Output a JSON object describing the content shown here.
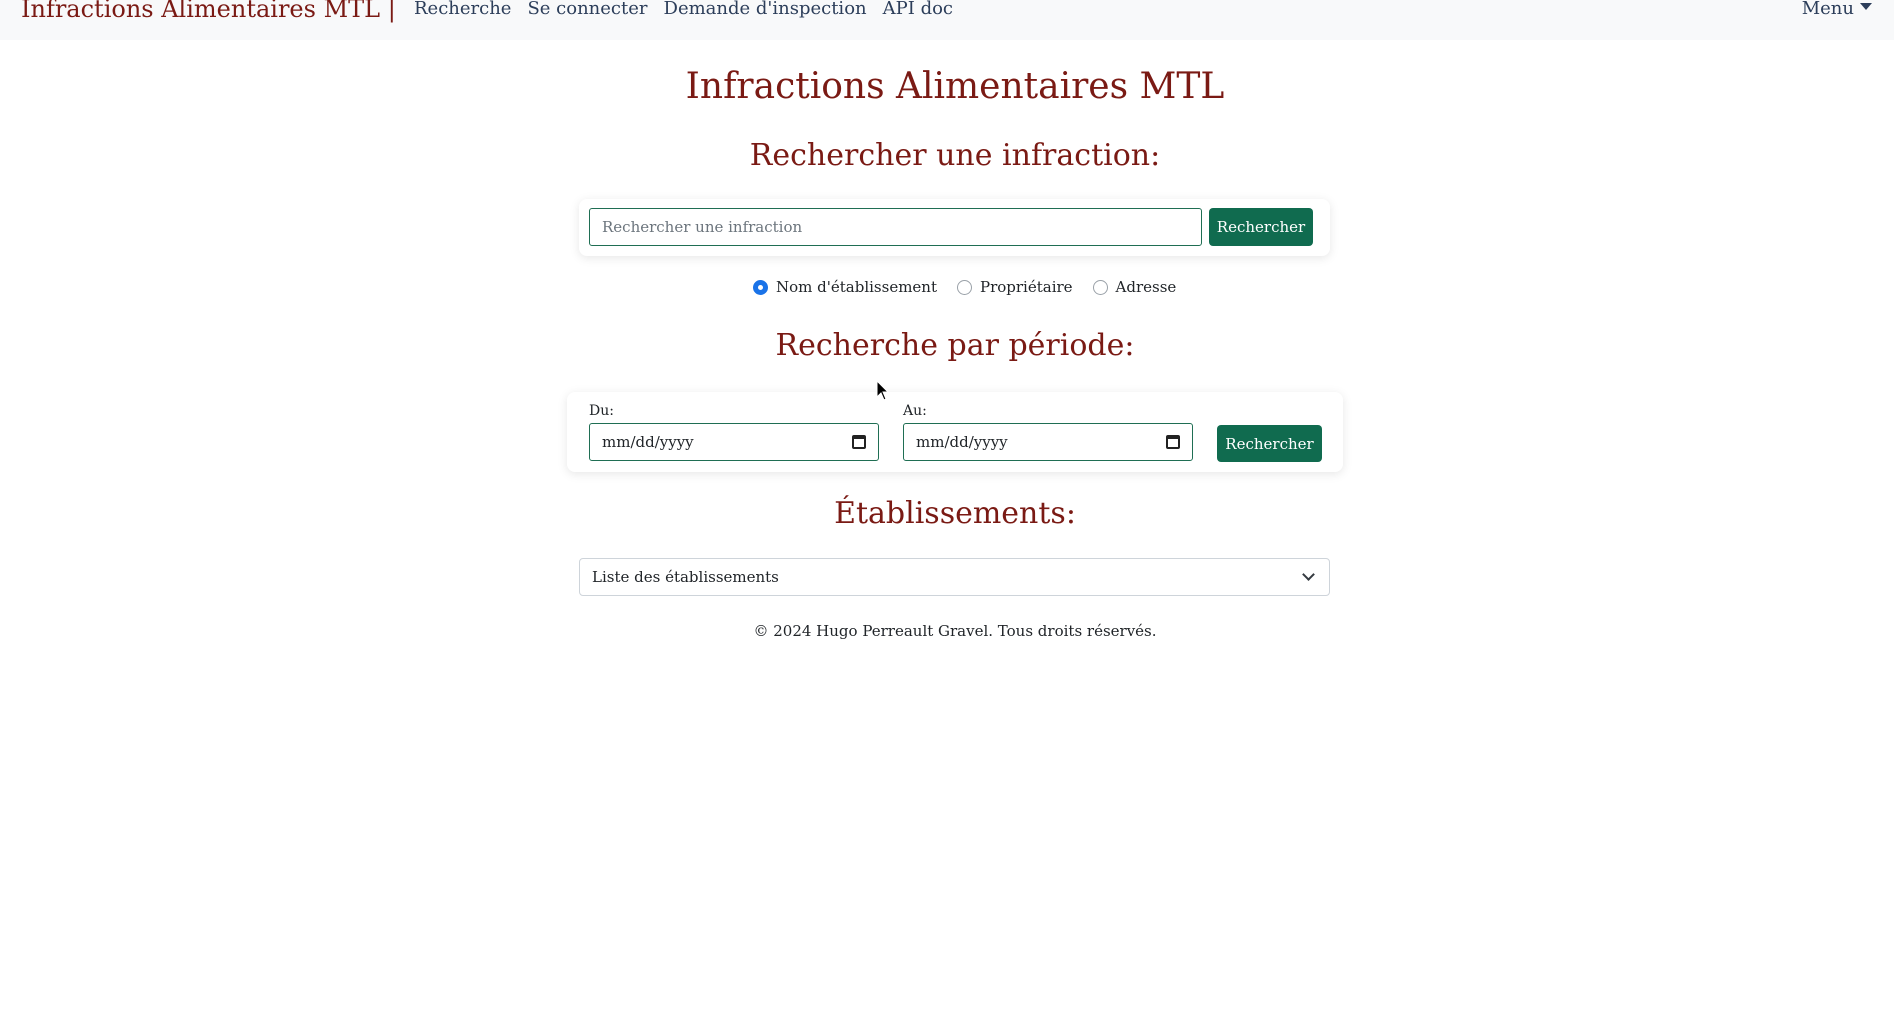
{
  "navbar": {
    "brand": "Infractions Alimentaires MTL |",
    "links": [
      "Recherche",
      "Se connecter",
      "Demande d'inspection",
      "API doc"
    ],
    "menu_label": "Menu"
  },
  "page_title": "Infractions Alimentaires MTL",
  "search_section": {
    "title": "Rechercher une infraction:",
    "input_placeholder": "Rechercher une infraction",
    "input_value": "",
    "button_label": "Rechercher",
    "radio_options": [
      {
        "label": "Nom d'établissement",
        "checked": true
      },
      {
        "label": "Propriétaire",
        "checked": false
      },
      {
        "label": "Adresse",
        "checked": false
      }
    ]
  },
  "period_section": {
    "title": "Recherche par période:",
    "from_label": "Du:",
    "from_value": "mm/dd/yyyy",
    "to_label": "Au:",
    "to_value": "mm/dd/yyyy",
    "button_label": "Rechercher"
  },
  "establishments_section": {
    "title": "Établissements:",
    "select_value": "Liste des établissements"
  },
  "footer": {
    "text": "© 2024 Hugo Perreault Gravel. Tous droits réservés."
  },
  "colors": {
    "accent_maroon": "#7a1a14",
    "button_green": "#106b4f",
    "navbar_bg": "#f8f9fa",
    "radio_blue": "#1a73e8"
  }
}
